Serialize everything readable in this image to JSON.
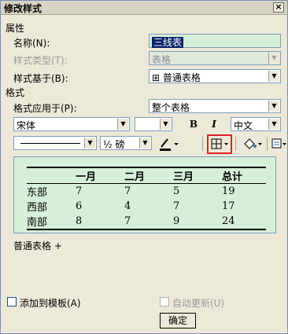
{
  "window": {
    "title": "修改样式",
    "close_icon": "×"
  },
  "properties": {
    "section_label": "属性",
    "name_label": "名称(N):",
    "name_value": "三线表",
    "type_label": "样式类型(T):",
    "type_value": "表格",
    "based_on_label": "样式基于(B):",
    "based_on_icon": "⊞",
    "based_on_value": "普通表格"
  },
  "format": {
    "section_label": "格式",
    "apply_to_label": "格式应用于(P):",
    "apply_to_value": "整个表格",
    "font_value": "宋体",
    "size_value": "",
    "bold": "B",
    "italic": "I",
    "lang_value": "中文",
    "line_weight": "½ 磅",
    "arrow": "▼"
  },
  "preview": {
    "headers": [
      "",
      "一月",
      "二月",
      "三月",
      "总计"
    ],
    "rows": [
      [
        "东部",
        "7",
        "7",
        "5",
        "19"
      ],
      [
        "西部",
        "6",
        "4",
        "7",
        "17"
      ],
      [
        "南部",
        "8",
        "7",
        "9",
        "24"
      ]
    ]
  },
  "description": "普通表格 +",
  "footer": {
    "add_to_template": "添加到模板(A)",
    "auto_update": "自动更新(U)",
    "ok": "确定"
  },
  "colors": {
    "field_bg": "#d6efd9",
    "highlight_border": "#e02020",
    "selection": "#0a246a"
  }
}
